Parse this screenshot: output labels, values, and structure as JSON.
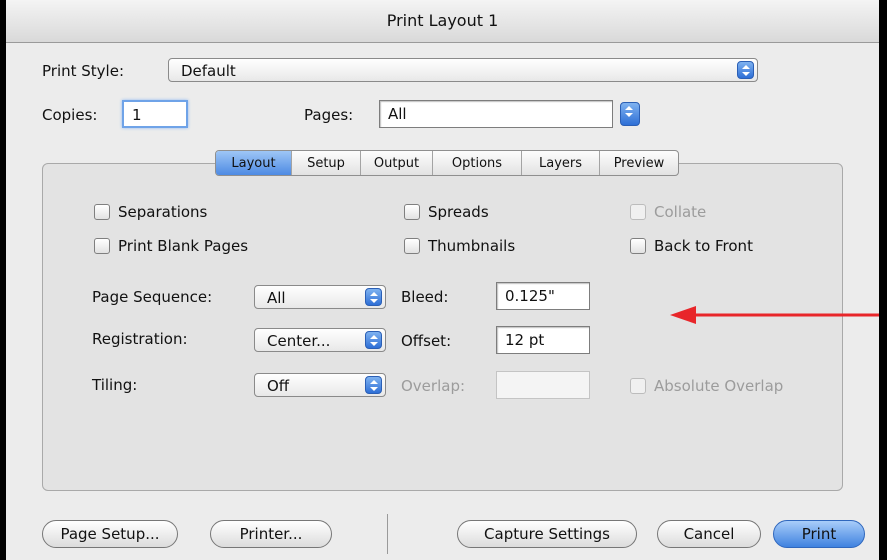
{
  "window": {
    "title": "Print Layout 1"
  },
  "print_style": {
    "label": "Print Style:",
    "value": "Default"
  },
  "copies": {
    "label": "Copies:",
    "value": "1"
  },
  "pages": {
    "label": "Pages:",
    "value": "All"
  },
  "tabs": [
    {
      "label": "Layout",
      "active": true
    },
    {
      "label": "Setup",
      "active": false
    },
    {
      "label": "Output",
      "active": false
    },
    {
      "label": "Options",
      "active": false
    },
    {
      "label": "Layers",
      "active": false
    },
    {
      "label": "Preview",
      "active": false
    }
  ],
  "checkboxes": {
    "separations": {
      "label": "Separations",
      "checked": false,
      "enabled": true
    },
    "spreads": {
      "label": "Spreads",
      "checked": false,
      "enabled": true
    },
    "collate": {
      "label": "Collate",
      "checked": false,
      "enabled": false
    },
    "print_blank_pages": {
      "label": "Print Blank Pages",
      "checked": false,
      "enabled": true
    },
    "thumbnails": {
      "label": "Thumbnails",
      "checked": false,
      "enabled": true
    },
    "back_to_front": {
      "label": "Back to Front",
      "checked": false,
      "enabled": true
    },
    "absolute_overlap": {
      "label": "Absolute Overlap",
      "checked": false,
      "enabled": false
    }
  },
  "page_sequence": {
    "label": "Page Sequence:",
    "value": "All"
  },
  "registration": {
    "label": "Registration:",
    "value": "Center..."
  },
  "tiling": {
    "label": "Tiling:",
    "value": "Off"
  },
  "bleed": {
    "label": "Bleed:",
    "value": "0.125\""
  },
  "offset": {
    "label": "Offset:",
    "value": "12 pt"
  },
  "overlap": {
    "label": "Overlap:",
    "value": ""
  },
  "buttons": {
    "page_setup": "Page Setup...",
    "printer": "Printer...",
    "capture_settings": "Capture Settings",
    "cancel": "Cancel",
    "print": "Print"
  },
  "colors": {
    "annotation_arrow": "#e8262a",
    "accent": "#3f82e0"
  }
}
